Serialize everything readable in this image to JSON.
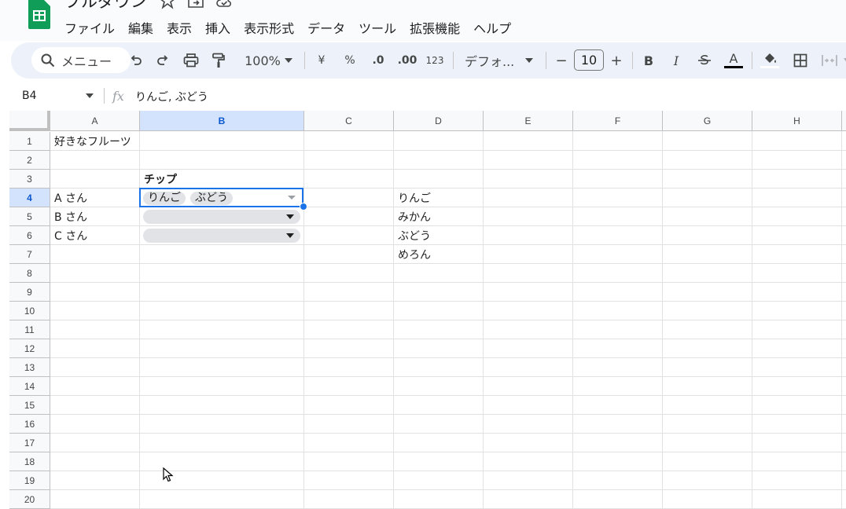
{
  "app": {
    "doc_title": "プルダウン",
    "accent": "#1a73e8",
    "logo_color": "#0f9d58"
  },
  "menu": [
    "ファイル",
    "編集",
    "表示",
    "挿入",
    "表示形式",
    "データ",
    "ツール",
    "拡張機能",
    "ヘルプ"
  ],
  "toolbar": {
    "search_label": "メニュー",
    "zoom": "100%",
    "currency": "¥",
    "percent": "%",
    "dec_decrease": ".0",
    "dec_increase": ".00",
    "format_123": "123",
    "font": "デフォ...",
    "font_size": "10",
    "bold": "B",
    "italic": "I",
    "text_color_label": "A",
    "minus": "−",
    "plus": "+"
  },
  "formula_bar": {
    "name_box": "B4",
    "fx": "fx",
    "content": "りんご, ぶどう"
  },
  "columns": [
    "A",
    "B",
    "C",
    "D",
    "E",
    "F",
    "G",
    "H"
  ],
  "rows": [
    "1",
    "2",
    "3",
    "4",
    "5",
    "6",
    "7",
    "8",
    "9",
    "10",
    "11",
    "12",
    "13",
    "14",
    "15",
    "16",
    "17",
    "18",
    "19",
    "20"
  ],
  "selected": {
    "column": "B",
    "row": "4"
  },
  "cells": {
    "A1": "好きなフルーツ",
    "B3": "チップ",
    "A4": "A さん",
    "A5": "B さん",
    "A6": "C さん",
    "D4": "りんご",
    "D5": "みかん",
    "D6": "ぶどう",
    "D7": "めろん"
  },
  "b4_chips": [
    "りんご",
    "ぶどう"
  ]
}
